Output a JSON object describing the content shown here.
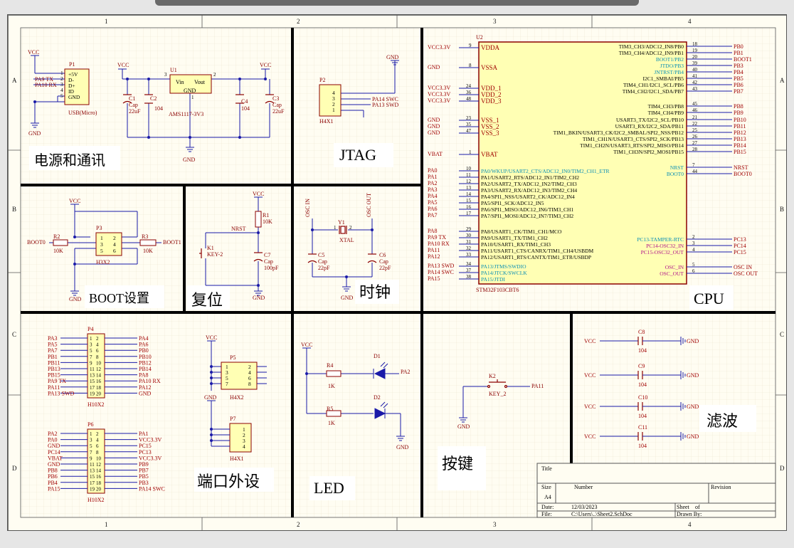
{
  "frame": {
    "cols": [
      "1",
      "2",
      "3",
      "4"
    ],
    "rows": [
      "A",
      "B",
      "C",
      "D"
    ]
  },
  "sections": {
    "power": "电源和通讯",
    "jtag": "JTAG",
    "boot": "BOOT设置",
    "reset": "复位",
    "clock": "时钟",
    "cpu": "CPU",
    "ports": "端口外设",
    "led": "LED",
    "key": "按键",
    "filter": "滤波"
  },
  "nets": {
    "vcc": "VCC",
    "gnd": "GND",
    "vcc33": "VCC3.3V",
    "nrst": "NRST",
    "boot0": "BOOT0",
    "boot1": "BOOT1",
    "osc_in": "OSC IN",
    "osc_out": "OSC OUT",
    "pa9tx": "PA9 TX",
    "pa10rx": "PA10 RX",
    "pa14swc": "PA14 SWC",
    "pa13swd": "PA13 SWD",
    "pa2": "PA2",
    "pa11": "PA11"
  },
  "p1": {
    "ref": "P1",
    "name": "USB(Micro)",
    "pins": [
      "+5V",
      "D-",
      "D+",
      "ID",
      "GND"
    ],
    "nums": [
      "1",
      "2",
      "3",
      "4",
      "5"
    ]
  },
  "u1": {
    "ref": "U1",
    "name": "AMS1117-3V3",
    "vin": "Vin",
    "vout": "Vout",
    "gnd": "GND",
    "p3": "3",
    "p2": "2",
    "p1": "1"
  },
  "caps_power": [
    {
      "ref": "C1",
      "type": "Cap",
      "val": "22uF"
    },
    {
      "ref": "C2",
      "type": "",
      "val": "104"
    },
    {
      "ref": "C4",
      "type": "",
      "val": "104"
    },
    {
      "ref": "C3",
      "type": "Cap",
      "val": "22uF"
    }
  ],
  "p2": {
    "ref": "P2",
    "name": "H4X1",
    "nums": [
      "4",
      "3",
      "2",
      "1"
    ]
  },
  "p3": {
    "ref": "P3",
    "name": "H3X2",
    "nums": [
      "1",
      "2",
      "3",
      "4",
      "5",
      "6"
    ]
  },
  "r2": {
    "ref": "R2",
    "val": "10K"
  },
  "r3": {
    "ref": "R3",
    "val": "10K"
  },
  "r1": {
    "ref": "R1",
    "val": "10K"
  },
  "c7": {
    "ref": "C7",
    "type": "Cap",
    "val": "100pF"
  },
  "k1": {
    "ref": "K1",
    "name": "KEY-2"
  },
  "y1": {
    "ref": "Y1",
    "name": "XTAL",
    "p1": "1",
    "p2": "2"
  },
  "c5": {
    "ref": "C5",
    "type": "Cap",
    "val": "22pF"
  },
  "c6": {
    "ref": "C6",
    "type": "Cap",
    "val": "22pF"
  },
  "u2": {
    "ref": "U2",
    "name": "STM32F103CBT6",
    "left": [
      {
        "net": "VCC3.3V",
        "num": "9",
        "pin": "VDDA",
        "c": "r"
      },
      {
        "net": "GND",
        "num": "8",
        "pin": "VSSA",
        "c": "r"
      },
      {
        "net": "VCC3.3V",
        "num": "24",
        "pin": "VDD_1",
        "c": "r"
      },
      {
        "net": "VCC3.3V",
        "num": "36",
        "pin": "VDD_2",
        "c": "r"
      },
      {
        "net": "VCC3.3V",
        "num": "48",
        "pin": "VDD_3",
        "c": "r"
      },
      {
        "net": "GND",
        "num": "23",
        "pin": "VSS_1",
        "c": "r"
      },
      {
        "net": "GND",
        "num": "35",
        "pin": "VSS_2",
        "c": "r"
      },
      {
        "net": "GND",
        "num": "47",
        "pin": "VSS_3",
        "c": "r"
      },
      {
        "net": "VBAT",
        "num": "1",
        "pin": "VBAT",
        "c": "r"
      },
      {
        "net": "PA0",
        "num": "10",
        "pin": "PA0/WKUP/USART2_CTS/ADC12_IN0/TIM2_CH1_ETR",
        "c": "b"
      },
      {
        "net": "PA1",
        "num": "11",
        "pin": "PA1/USART2_RTS/ADC12_IN1/TIM2_CH2",
        "c": "k"
      },
      {
        "net": "PA2",
        "num": "12",
        "pin": "PA2/USART2_TX/ADC12_IN2/TIM2_CH3",
        "c": "k"
      },
      {
        "net": "PA3",
        "num": "13",
        "pin": "PA3/USART2_RX/ADC12_IN3/TIM2_CH4",
        "c": "k"
      },
      {
        "net": "PA4",
        "num": "14",
        "pin": "PA4/SPI1_NSS/USART2_CK/ADC12_IN4",
        "c": "k"
      },
      {
        "net": "PA5",
        "num": "15",
        "pin": "PA5/SPI1_SCK/ADC12_IN5",
        "c": "k"
      },
      {
        "net": "PA6",
        "num": "16",
        "pin": "PA6/SPI1_MISO/ADC12_IN6/TIM3_CH1",
        "c": "k"
      },
      {
        "net": "PA7",
        "num": "17",
        "pin": "PA7/SPI1_MOSI/ADC12_IN7/TIM3_CH2",
        "c": "k"
      },
      {
        "net": "PA8",
        "num": "29",
        "pin": "PA8/USART1_CK/TIM1_CH1/MCO",
        "c": "k"
      },
      {
        "net": "PA9 TX",
        "num": "30",
        "pin": "PA9/USART1_TX/TIM1_CH2",
        "c": "k"
      },
      {
        "net": "PA10 RX",
        "num": "31",
        "pin": "PA10/USART1_RX/TIM1_CH3",
        "c": "k"
      },
      {
        "net": "PA11",
        "num": "32",
        "pin": "PA11/USART1_CTS/CANRX/TIM1_CH4/USBDM",
        "c": "k"
      },
      {
        "net": "PA12",
        "num": "33",
        "pin": "PA12/USART1_RTS/CANTX/TIM1_ETR/USBDP",
        "c": "k"
      },
      {
        "net": "PA13 SWD",
        "num": "34",
        "pin": "PA13/JTMS/SWDIO",
        "c": "b"
      },
      {
        "net": "PA14 SWC",
        "num": "37",
        "pin": "PA14/JTCK/SWCLK",
        "c": "b"
      },
      {
        "net": "PA15",
        "num": "38",
        "pin": "PA15/JTDI",
        "c": "b"
      }
    ],
    "right": [
      {
        "net": "PB0",
        "num": "18",
        "pin": "TIM3_CH3/ADC12_IN8/PB0",
        "c": "k"
      },
      {
        "net": "PB1",
        "num": "19",
        "pin": "TIM3_CH4/ADC12_IN9/PB1",
        "c": "k"
      },
      {
        "net": "BOOT1",
        "num": "20",
        "pin": "BOOT1/PB2",
        "c": "b"
      },
      {
        "net": "PB3",
        "num": "39",
        "pin": "JTDO/PB3",
        "c": "b"
      },
      {
        "net": "PB4",
        "num": "40",
        "pin": "JNTRST/PB4",
        "c": "b"
      },
      {
        "net": "PB5",
        "num": "41",
        "pin": "I2C1_SMBAI/PB5",
        "c": "k"
      },
      {
        "net": "PB6",
        "num": "42",
        "pin": "TIM4_CH1/I2C1_SCL/PB6",
        "c": "k"
      },
      {
        "net": "PB7",
        "num": "43",
        "pin": "TIM4_CH2/I2C1_SDA/PB7",
        "c": "k"
      },
      {
        "net": "PB8",
        "num": "45",
        "pin": "TIM4_CH3/PB8",
        "c": "k"
      },
      {
        "net": "PB9",
        "num": "46",
        "pin": "TIM4_CH4/PB9",
        "c": "k"
      },
      {
        "net": "PB10",
        "num": "21",
        "pin": "USART3_TX/I2C2_SCL/PB10",
        "c": "k"
      },
      {
        "net": "PB11",
        "num": "22",
        "pin": "USART3_RX/I2C2_SDA/PB11",
        "c": "k"
      },
      {
        "net": "PB12",
        "num": "25",
        "pin": "TIM1_BKIN/USART3_CK/I2C2_SMBAL/SPI2_NSS/PB12",
        "c": "k"
      },
      {
        "net": "PB13",
        "num": "26",
        "pin": "TIM1_CH1N/USART3_CTS/SPI2_SCK/PB13",
        "c": "k"
      },
      {
        "net": "PB14",
        "num": "27",
        "pin": "TIM1_CH2N/USART3_RTS/SPI2_MISO/PB14",
        "c": "k"
      },
      {
        "net": "PB15",
        "num": "28",
        "pin": "TIM1_CH3N/SPI2_MOSI/PB15",
        "c": "k"
      },
      {
        "net": "NRST",
        "num": "7",
        "pin": "NRST",
        "c": "b"
      },
      {
        "net": "BOOT0",
        "num": "44",
        "pin": "BOOT0",
        "c": "b"
      },
      {
        "net": "PC13",
        "num": "2",
        "pin": "PC13-TAMPER-RTC",
        "c": "b"
      },
      {
        "net": "PC14",
        "num": "3",
        "pin": "PC14-OSC32_IN",
        "c": "m"
      },
      {
        "net": "PC15",
        "num": "4",
        "pin": "PC15-OSC32_OUT",
        "c": "m"
      },
      {
        "net": "OSC IN",
        "num": "5",
        "pin": "OSC_IN",
        "c": "m"
      },
      {
        "net": "OSC OUT",
        "num": "6",
        "pin": "OSC_OUT",
        "c": "m"
      }
    ]
  },
  "p4": {
    "ref": "P4",
    "name": "H10X2",
    "left": [
      "PA3",
      "PA5",
      "PA7",
      "PB1",
      "PB11",
      "PB13",
      "PB15",
      "PA9 TX",
      "PA11",
      "PA13 SWD"
    ],
    "lnum": [
      "1",
      "3",
      "5",
      "7",
      "9",
      "11",
      "13",
      "15",
      "17",
      "19"
    ],
    "right": [
      "PA4",
      "PA6",
      "PB0",
      "PB10",
      "PB12",
      "PB14",
      "PA8",
      "PA10 RX",
      "PA12",
      "GND"
    ],
    "rnum": [
      "2",
      "4",
      "6",
      "8",
      "10",
      "12",
      "14",
      "16",
      "18",
      "20"
    ]
  },
  "p6": {
    "ref": "P6",
    "name": "H10X2",
    "left": [
      "PA2",
      "PA0",
      "GND",
      "PC14",
      "VBAT",
      "GND",
      "PB8",
      "PB6",
      "PB4",
      "PA15"
    ],
    "lnum": [
      "1",
      "3",
      "5",
      "7",
      "9",
      "11",
      "13",
      "15",
      "17",
      "19"
    ],
    "right": [
      "PA1",
      "VCC3.3V",
      "PC15",
      "PC13",
      "VCC3.3V",
      "PB9",
      "PB7",
      "PB5",
      "PB3",
      "PA14 SWC"
    ],
    "rnum": [
      "2",
      "4",
      "6",
      "8",
      "10",
      "12",
      "14",
      "16",
      "18",
      "20"
    ]
  },
  "p5": {
    "ref": "P5",
    "name": "H4X2",
    "lnum": [
      "1",
      "3",
      "5",
      "7"
    ],
    "rnum": [
      "2",
      "4",
      "6",
      "8"
    ]
  },
  "p7": {
    "ref": "P7",
    "name": "H4X1",
    "nums": [
      "1",
      "2",
      "3",
      "4"
    ]
  },
  "led": {
    "r4": {
      "ref": "R4",
      "val": "1K"
    },
    "r5": {
      "ref": "R5",
      "val": "1K"
    },
    "d1": "D1",
    "d2": "D2"
  },
  "k2": {
    "ref": "K2",
    "name": "KEY_2"
  },
  "filter_caps": [
    {
      "ref": "C8",
      "val": "104"
    },
    {
      "ref": "C9",
      "val": "104"
    },
    {
      "ref": "C10",
      "val": "104"
    },
    {
      "ref": "C11",
      "val": "104"
    }
  ],
  "titleblock": {
    "title": "Title",
    "size": "Size",
    "size_val": "A4",
    "number": "Number",
    "revision": "Revision",
    "date": "Date:",
    "date_val": "12/03/2023",
    "sheet": "Sheet",
    "of": "of",
    "file": "File:",
    "file_val": "C:\\Users\\..\\Sheet2.SchDoc",
    "drawn": "Drawn By:"
  },
  "colors": {
    "paper": "#fffdf2",
    "grid": "#ece6cf",
    "wire": "#1a1aa8",
    "part_fill": "#ffffb4",
    "part_border": "#8b0000",
    "net_red": "#a00000",
    "pin_blue": "#0a8fb5",
    "pin_magenta": "#b0108a",
    "partition": "#000000"
  }
}
